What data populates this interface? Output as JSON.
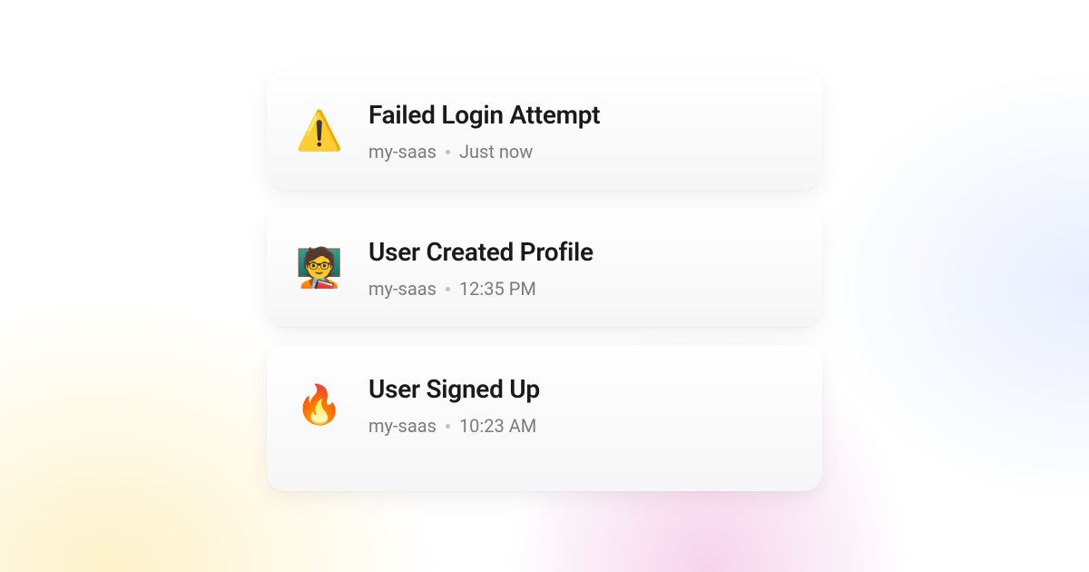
{
  "notifications": [
    {
      "icon": "⚠️",
      "icon_name": "warning-icon",
      "title": "Failed Login Attempt",
      "project": "my-saas",
      "time": "Just now"
    },
    {
      "icon": "🧑‍🏫",
      "icon_name": "teacher-icon",
      "title": "User Created Profile",
      "project": "my-saas",
      "time": "12:35 PM"
    },
    {
      "icon": "🔥",
      "icon_name": "fire-icon",
      "title": "User Signed Up",
      "project": "my-saas",
      "time": "10:23 AM"
    }
  ]
}
